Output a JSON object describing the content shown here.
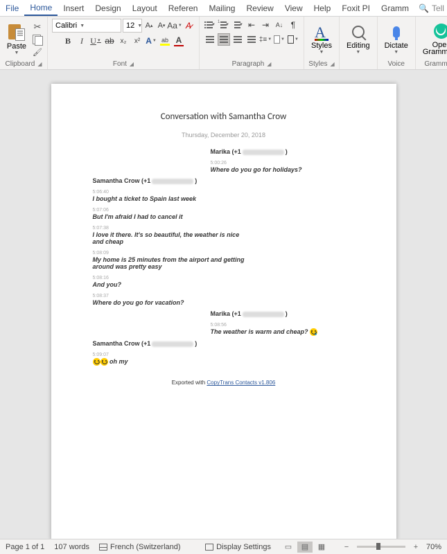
{
  "menu": {
    "file": "File",
    "home": "Home",
    "insert": "Insert",
    "design": "Design",
    "layout": "Layout",
    "references": "Referen",
    "mailings": "Mailing",
    "review": "Review",
    "view": "View",
    "help": "Help",
    "foxit": "Foxit PI",
    "grammarly": "Gramm",
    "tellme": "Tell me"
  },
  "ribbon": {
    "clipboard": {
      "label": "Clipboard",
      "paste": "Paste"
    },
    "font": {
      "label": "Font",
      "name": "Calibri",
      "size": "12"
    },
    "paragraph": {
      "label": "Paragraph"
    },
    "styles": {
      "label": "Styles",
      "btn": "Styles"
    },
    "editing": {
      "label": "",
      "btn": "Editing"
    },
    "voice": {
      "label": "Voice",
      "btn": "Dictate"
    },
    "grammarly": {
      "label": "Grammarly",
      "btn1": "Open",
      "btn2": "Grammarly"
    }
  },
  "doc": {
    "title": "Conversation with Samantha Crow",
    "date": "Thursday, December 20, 2018",
    "marika": "Marika (+1",
    "samantha": "Samantha Crow (+1",
    "closeParen": ")",
    "ts1": "5:00:26",
    "m1": "Where do you go for holidays?",
    "ts2": "5:06:40",
    "m2": "I bought a ticket to Spain last week",
    "ts3": "5:07:06",
    "m3": "But I'm afraid I had to cancel it",
    "ts4": "5:07:38",
    "m4": "I love it there. It's so beautiful, the weather is nice and cheap",
    "ts5": "5:08:09",
    "m5": "My home is 25 minutes from the airport and getting around was pretty easy",
    "ts6": "5:08:16",
    "m6": "And you?",
    "ts7": "5:08:37",
    "m7": "Where do you go for vacation?",
    "ts8": "5:08:56",
    "m8": "The weather is warm and cheap?",
    "ts9": "5:09:07",
    "m9": "oh my",
    "footerPre": "Exported with ",
    "footerLink": "CopyTrans Contacts v1.806"
  },
  "status": {
    "page": "Page 1 of 1",
    "words": "107 words",
    "lang": "French (Switzerland)",
    "display": "Display Settings",
    "zoom": "70%"
  }
}
